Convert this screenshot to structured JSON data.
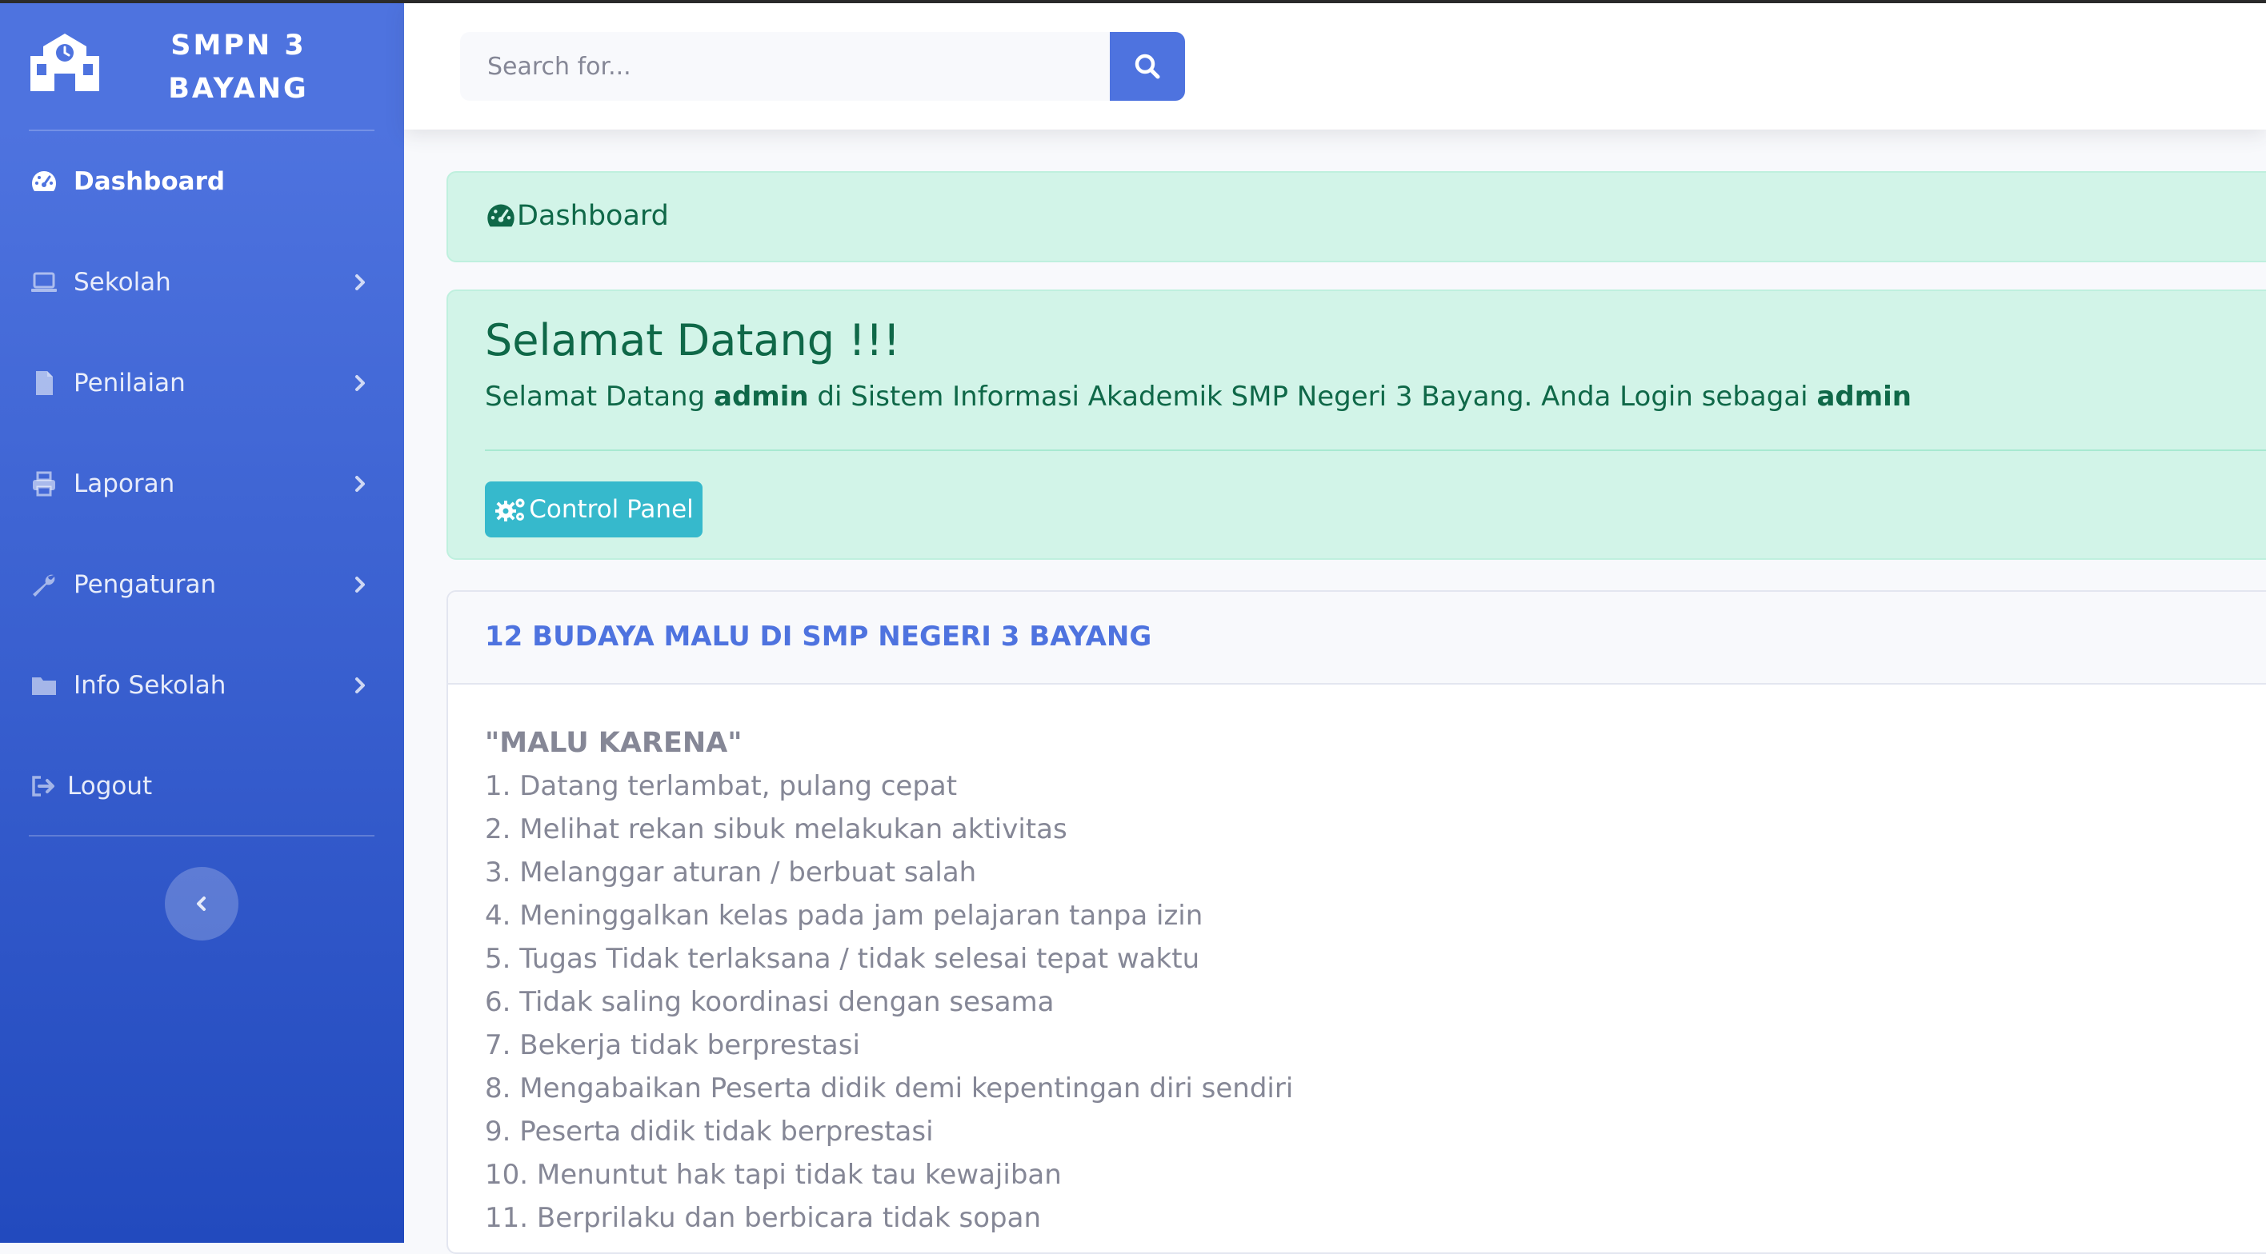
{
  "sidebar": {
    "brand_line1": "SMPN 3",
    "brand_line2": "BAYANG",
    "brand_icon": "school-icon",
    "items": [
      {
        "label": "Dashboard",
        "icon": "tachometer-icon",
        "active": true,
        "has_chevron": false
      },
      {
        "label": "Sekolah",
        "icon": "laptop-icon",
        "active": false,
        "has_chevron": true
      },
      {
        "label": "Penilaian",
        "icon": "file-icon",
        "active": false,
        "has_chevron": true
      },
      {
        "label": "Laporan",
        "icon": "print-icon",
        "active": false,
        "has_chevron": true
      },
      {
        "label": "Pengaturan",
        "icon": "wrench-icon",
        "active": false,
        "has_chevron": true
      },
      {
        "label": "Info Sekolah",
        "icon": "folder-icon",
        "active": false,
        "has_chevron": true
      },
      {
        "label": "Logout",
        "icon": "sign-out-icon",
        "active": false,
        "has_chevron": false
      }
    ],
    "toggle_icon": "chevron-left-icon"
  },
  "topbar": {
    "search_placeholder": "Search for...",
    "search_icon": "search-icon"
  },
  "breadcrumb": {
    "icon": "tachometer-icon",
    "label": "Dashboard"
  },
  "welcome": {
    "title": "Selamat Datang !!!",
    "text_before": "Selamat Datang ",
    "user": "admin",
    "text_middle": " di Sistem Informasi Akademik SMP Negeri 3 Bayang. Anda Login sebagai ",
    "role": "admin",
    "button_label": "Control Panel",
    "button_icon": "cogs-icon"
  },
  "card": {
    "title": "12 BUDAYA MALU DI SMP NEGERI 3 BAYANG",
    "heading": "\"MALU KARENA\"",
    "items": [
      "1. Datang terlambat, pulang cepat",
      "2. Melihat rekan sibuk melakukan aktivitas",
      "3. Melanggar aturan / berbuat salah",
      "4. Meninggalkan kelas pada jam pelajaran tanpa izin",
      "5. Tugas Tidak terlaksana / tidak selesai tepat waktu",
      "6. Tidak saling koordinasi dengan sesama",
      "7. Bekerja tidak berprestasi",
      "8. Mengabaikan Peserta didik demi kepentingan diri sendiri",
      "9. Peserta didik tidak berprestasi",
      "10. Menuntut hak tapi tidak tau kewajiban",
      "11. Berprilaku dan berbicara tidak sopan"
    ]
  },
  "colors": {
    "primary": "#4e73df",
    "success_bg": "#d2f4e8",
    "success_text": "#0f6848",
    "info": "#36b9cc"
  }
}
